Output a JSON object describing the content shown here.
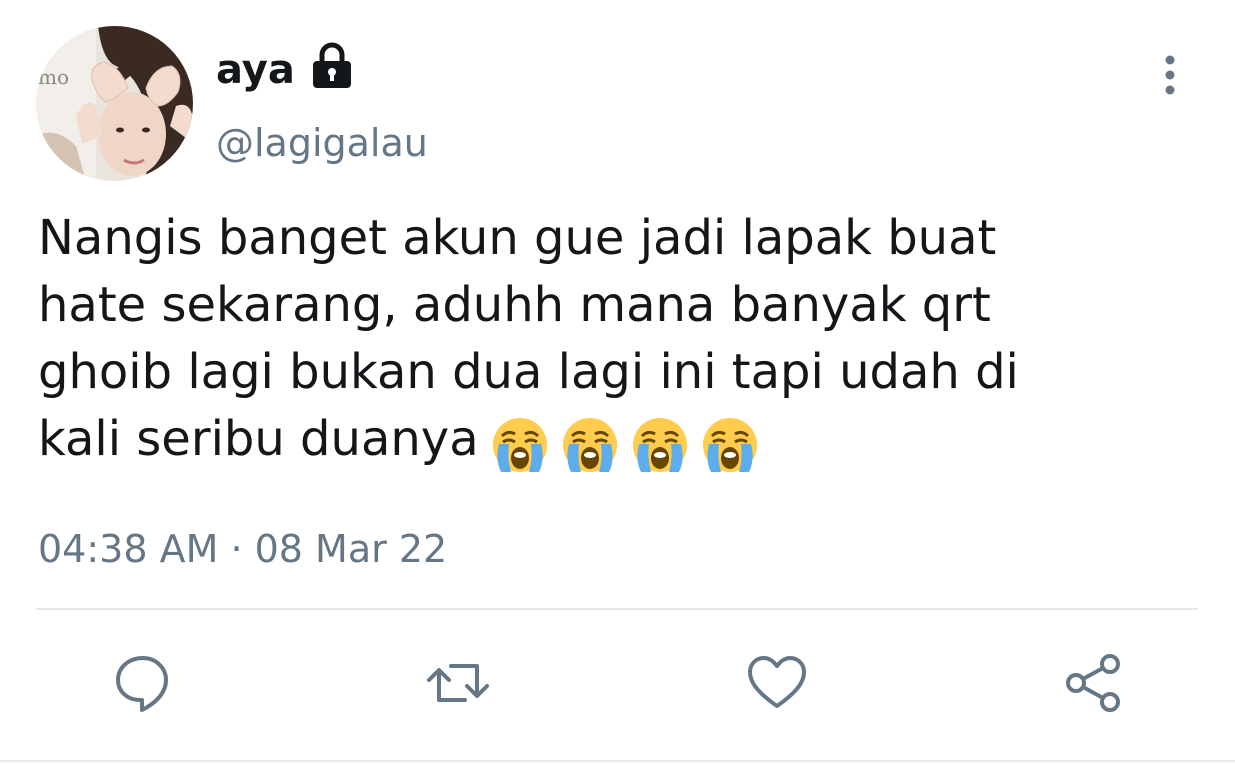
{
  "author": {
    "display_name": "aya",
    "handle": "@lagigalau",
    "protected": true,
    "avatar": "profile-photo"
  },
  "tweet": {
    "text": "Nangis banget akun gue jadi lapak buat\nhate sekarang, aduhh mana banyak qrt\nghoib lagi bukan dua lagi ini tapi udah di\nkali seribu duanya",
    "emojis": [
      "loudly-crying-face",
      "loudly-crying-face",
      "loudly-crying-face",
      "loudly-crying-face"
    ],
    "timestamp": "04:38 AM · 08 Mar 22"
  },
  "actions": [
    "reply-icon",
    "retweet-icon",
    "like-icon",
    "share-icon"
  ],
  "colors": {
    "text_primary": "#14171a",
    "text_secondary": "#657786",
    "divider": "#e1e8ed"
  }
}
